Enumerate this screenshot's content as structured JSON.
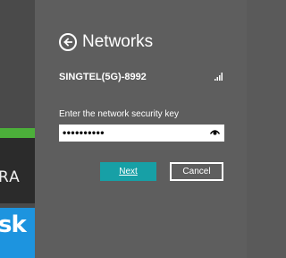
{
  "background": {
    "tile_dark_text": "RA",
    "tile_sky_text": "sk",
    "colors": {
      "green": "#4caf3a",
      "sky": "#1d94df"
    }
  },
  "panel": {
    "back_icon": "back-arrow-icon",
    "title": "Networks",
    "network": {
      "name": "SINGTEL(5G)-8992",
      "signal_icon": "signal-strength-icon"
    },
    "security_key": {
      "label": "Enter the network security key",
      "value": "••••••••••",
      "reveal_icon": "eye-icon"
    },
    "buttons": {
      "next": "Next",
      "cancel": "Cancel"
    },
    "colors": {
      "panel": "#5e5e5e",
      "accent": "#17a0a6"
    }
  }
}
